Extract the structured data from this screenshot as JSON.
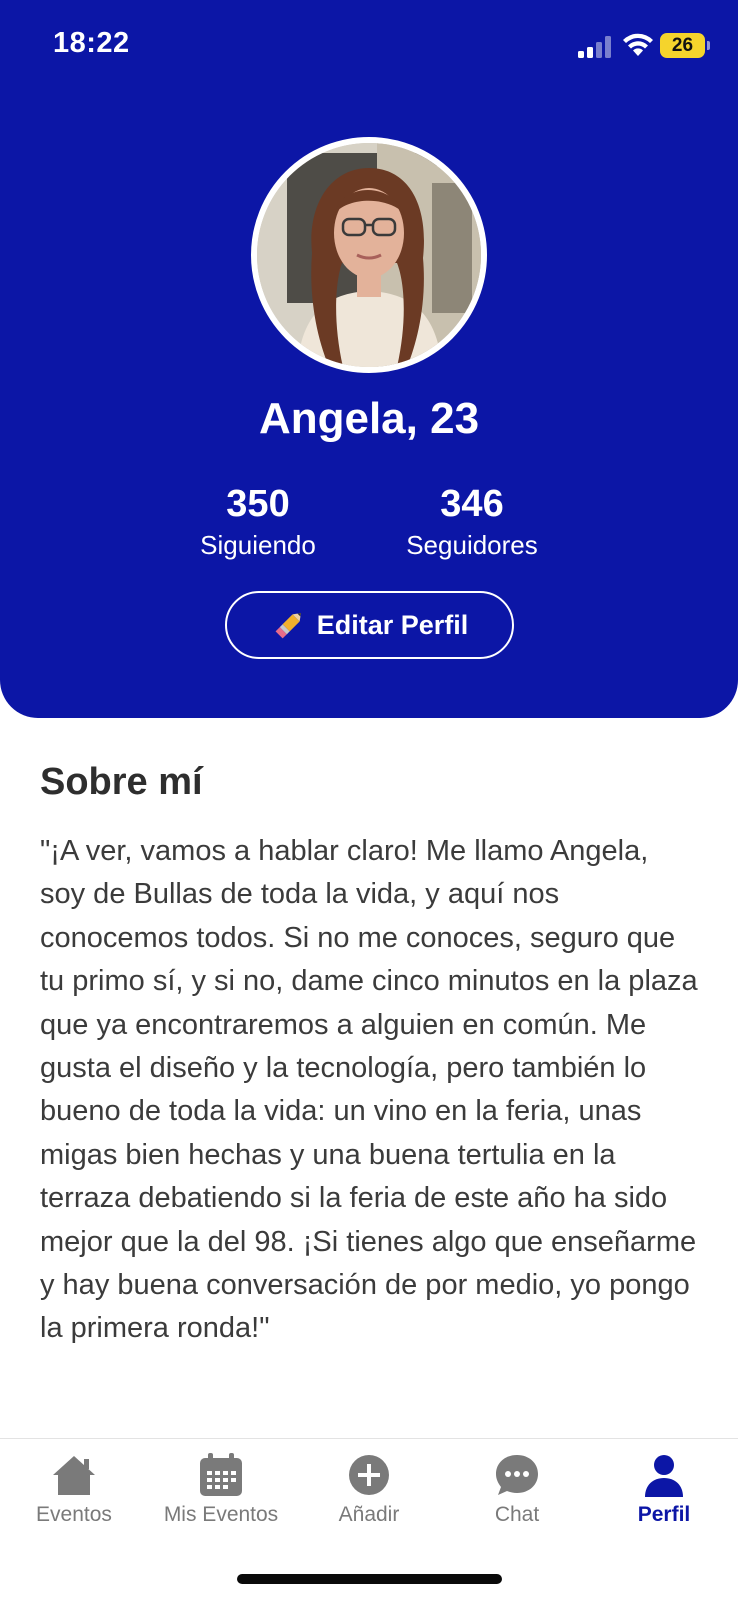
{
  "status_bar": {
    "time": "18:22",
    "battery": "26"
  },
  "profile": {
    "name_age": "Angela, 23",
    "following_count": "350",
    "following_label": "Siguiendo",
    "followers_count": "346",
    "followers_label": "Seguidores",
    "edit_button_label": "Editar Perfil"
  },
  "about": {
    "title": "Sobre mí",
    "text": "\"¡A ver, vamos a hablar claro! Me llamo Angela, soy de Bullas de toda la vida, y aquí nos conocemos todos. Si no me conoces, seguro que tu primo sí, y si no, dame cinco minutos en la plaza que ya encontraremos a alguien en común. Me gusta el diseño y la tecnología, pero también lo bueno de toda la vida: un vino en la feria, unas migas bien hechas y una buena tertulia en la terraza debatiendo si la feria de este año ha sido mejor que la del 98. ¡Si tienes algo que enseñarme y hay buena conversación de por medio, yo pongo la primera ronda!\""
  },
  "tabs": [
    {
      "label": "Eventos",
      "icon": "home-icon",
      "active": false
    },
    {
      "label": "Mis Eventos",
      "icon": "calendar-icon",
      "active": false
    },
    {
      "label": "Añadir",
      "icon": "plus-circle-icon",
      "active": false
    },
    {
      "label": "Chat",
      "icon": "chat-bubble-icon",
      "active": false
    },
    {
      "label": "Perfil",
      "icon": "person-icon",
      "active": true
    }
  ],
  "colors": {
    "brand": "#0c16a6",
    "battery": "#f5d42c",
    "inactive_tab": "#7a7a7a"
  }
}
